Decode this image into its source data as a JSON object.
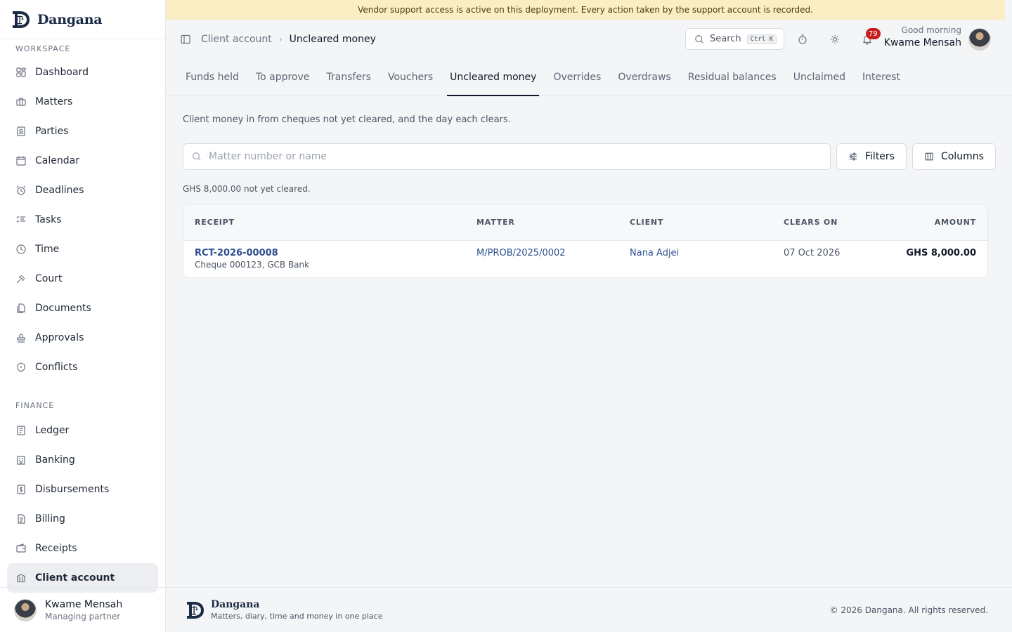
{
  "brand": {
    "name": "Dangana",
    "tagline": "Matters, diary, time and money in one place"
  },
  "banner": {
    "text": "Vendor support access is active on this deployment. Every action taken by the support account is recorded."
  },
  "sidebar": {
    "workspace_label": "WORKSPACE",
    "finance_label": "FINANCE",
    "workspace_items": [
      "Dashboard",
      "Matters",
      "Parties",
      "Calendar",
      "Deadlines",
      "Tasks",
      "Time",
      "Court",
      "Documents",
      "Approvals",
      "Conflicts"
    ],
    "finance_items": [
      "Ledger",
      "Banking",
      "Disbursements",
      "Billing",
      "Receipts",
      "Client account"
    ],
    "user": {
      "name": "Kwame Mensah",
      "role": "Managing partner"
    }
  },
  "header": {
    "breadcrumb": [
      "Client account",
      "Uncleared money"
    ],
    "search_label": "Search",
    "search_shortcut": "Ctrl K",
    "notification_count": "79",
    "greeting": "Good morning",
    "user_name": "Kwame Mensah"
  },
  "tabs": [
    "Funds held",
    "To approve",
    "Transfers",
    "Vouchers",
    "Uncleared money",
    "Overrides",
    "Overdraws",
    "Residual balances",
    "Unclaimed",
    "Interest"
  ],
  "main": {
    "description": "Client money in from cheques not yet cleared, and the day each clears.",
    "search_placeholder": "Matter number or name",
    "filters_label": "Filters",
    "columns_label": "Columns",
    "summary": "GHS 8,000.00 not yet cleared.",
    "table": {
      "headers": [
        "RECEIPT",
        "MATTER",
        "CLIENT",
        "CLEARS ON",
        "AMOUNT"
      ],
      "rows": [
        {
          "receipt": "RCT-2026-00008",
          "receipt_detail": "Cheque 000123, GCB Bank",
          "matter": "M/PROB/2025/0002",
          "client": "Nana Adjei",
          "clears_on": "07 Oct 2026",
          "amount": "GHS 8,000.00"
        }
      ]
    }
  },
  "footer": {
    "copyright": "© 2026 Dangana. All rights reserved."
  }
}
